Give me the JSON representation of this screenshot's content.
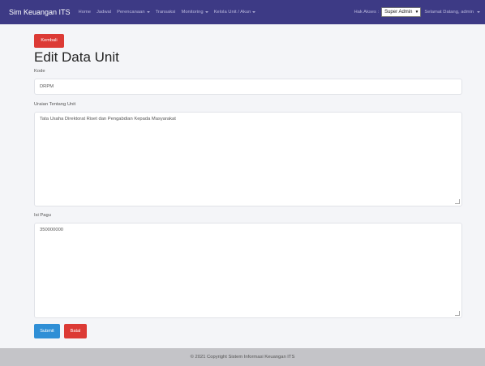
{
  "navbar": {
    "brand": "Sim Keuangan ITS",
    "items": [
      {
        "label": "Home",
        "dropdown": false
      },
      {
        "label": "Jadwal",
        "dropdown": false
      },
      {
        "label": "Perencanaan",
        "dropdown": true
      },
      {
        "label": "Transaksi",
        "dropdown": false
      },
      {
        "label": "Monitoring",
        "dropdown": true
      },
      {
        "label": "Kelola Unit / Akun",
        "dropdown": true
      }
    ],
    "hak_akses_label": "Hak Akses :",
    "hak_akses_value": "Super Admin",
    "greeting": "Selamat Datang, admin"
  },
  "form": {
    "back_label": "Kembali",
    "title": "Edit Data Unit",
    "kode_label": "Kode",
    "kode_value": "DRPM",
    "uraian_label": "Uraian Tentang Unit",
    "uraian_value": "Tata Usaha Direktorat Riset dan Pengabdian Kepada Masyarakat",
    "pagu_label": "Isi Pagu",
    "pagu_value": "350000000",
    "submit_label": "Submit",
    "batal_label": "Batal"
  },
  "footer": {
    "text": "© 2021 Copyright Sistem Informasi Keuangan ITS"
  },
  "colors": {
    "navbar": "#3d3a85",
    "danger": "#dc3a35",
    "primary": "#2f8fd6",
    "footer": "#c4c4c8"
  }
}
